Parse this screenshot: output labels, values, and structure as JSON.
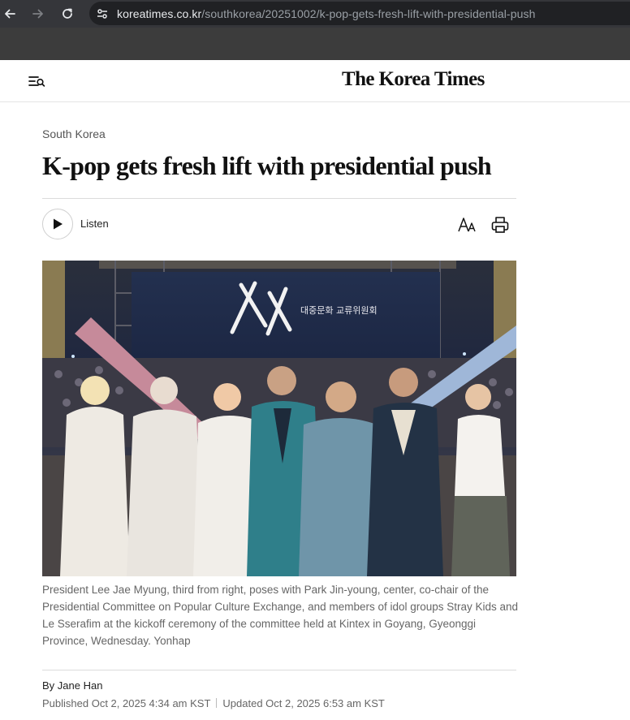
{
  "browser": {
    "url_host": "koreatimes.co.kr",
    "url_path": "/southkorea/20251002/k-pop-gets-fresh-lift-with-presidential-push"
  },
  "header": {
    "logo_text": "The Korea Times",
    "menu_icon": "menu-search-icon"
  },
  "article": {
    "category": "South Korea",
    "headline": "K-pop gets fresh lift with presidential push",
    "listen_label": "Listen",
    "photo_sign_text": "대중문화 교류위원회",
    "caption": "President Lee Jae Myung, third from right, poses with Park Jin-young, center, co-chair of the Presidential Committee on Popular Culture Exchange, and members of idol groups Stray Kids and Le Sserafim at the kickoff ceremony of the committee held at Kintex in Goyang, Gyeonggi Province, Wednesday. Yonhap",
    "byline_prefix": "By",
    "author": "Jane Han",
    "published": "Published Oct 2, 2025 4:34 am KST",
    "updated": "Updated Oct 2, 2025 6:53 am KST"
  },
  "icons": {
    "back": "arrow-left-icon",
    "forward": "arrow-right-icon",
    "reload": "reload-icon",
    "site_info": "tune-icon",
    "play": "play-icon",
    "font_size": "font-size-icon",
    "print": "print-icon"
  },
  "colors": {
    "chrome_dark": "#35363a",
    "omnibox": "#202124",
    "headline": "#111111",
    "caption": "#666666"
  }
}
